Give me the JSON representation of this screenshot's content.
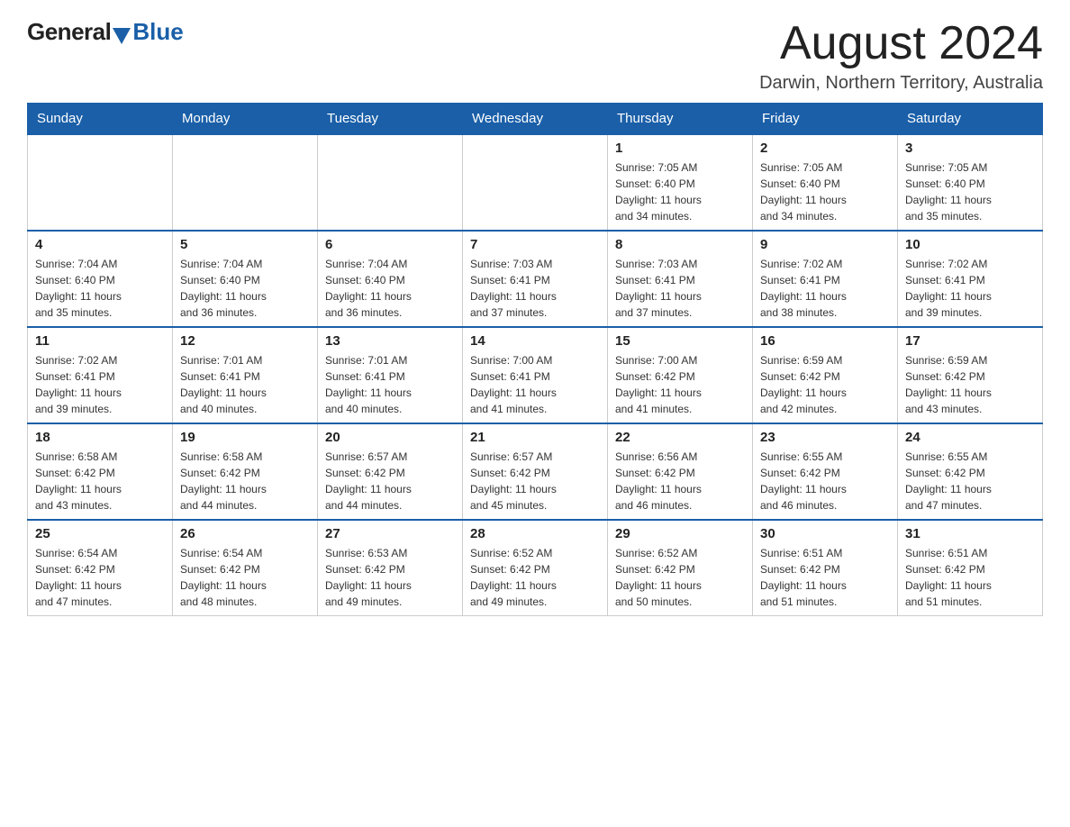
{
  "header": {
    "logo_general": "General",
    "logo_blue": "Blue",
    "month_title": "August 2024",
    "location": "Darwin, Northern Territory, Australia"
  },
  "days_of_week": [
    "Sunday",
    "Monday",
    "Tuesday",
    "Wednesday",
    "Thursday",
    "Friday",
    "Saturday"
  ],
  "weeks": [
    [
      {
        "day": "",
        "sunrise": "",
        "sunset": "",
        "daylight": ""
      },
      {
        "day": "",
        "sunrise": "",
        "sunset": "",
        "daylight": ""
      },
      {
        "day": "",
        "sunrise": "",
        "sunset": "",
        "daylight": ""
      },
      {
        "day": "",
        "sunrise": "",
        "sunset": "",
        "daylight": ""
      },
      {
        "day": "1",
        "sunrise": "Sunrise: 7:05 AM",
        "sunset": "Sunset: 6:40 PM",
        "daylight": "Daylight: 11 hours and 34 minutes."
      },
      {
        "day": "2",
        "sunrise": "Sunrise: 7:05 AM",
        "sunset": "Sunset: 6:40 PM",
        "daylight": "Daylight: 11 hours and 34 minutes."
      },
      {
        "day": "3",
        "sunrise": "Sunrise: 7:05 AM",
        "sunset": "Sunset: 6:40 PM",
        "daylight": "Daylight: 11 hours and 35 minutes."
      }
    ],
    [
      {
        "day": "4",
        "sunrise": "Sunrise: 7:04 AM",
        "sunset": "Sunset: 6:40 PM",
        "daylight": "Daylight: 11 hours and 35 minutes."
      },
      {
        "day": "5",
        "sunrise": "Sunrise: 7:04 AM",
        "sunset": "Sunset: 6:40 PM",
        "daylight": "Daylight: 11 hours and 36 minutes."
      },
      {
        "day": "6",
        "sunrise": "Sunrise: 7:04 AM",
        "sunset": "Sunset: 6:40 PM",
        "daylight": "Daylight: 11 hours and 36 minutes."
      },
      {
        "day": "7",
        "sunrise": "Sunrise: 7:03 AM",
        "sunset": "Sunset: 6:41 PM",
        "daylight": "Daylight: 11 hours and 37 minutes."
      },
      {
        "day": "8",
        "sunrise": "Sunrise: 7:03 AM",
        "sunset": "Sunset: 6:41 PM",
        "daylight": "Daylight: 11 hours and 37 minutes."
      },
      {
        "day": "9",
        "sunrise": "Sunrise: 7:02 AM",
        "sunset": "Sunset: 6:41 PM",
        "daylight": "Daylight: 11 hours and 38 minutes."
      },
      {
        "day": "10",
        "sunrise": "Sunrise: 7:02 AM",
        "sunset": "Sunset: 6:41 PM",
        "daylight": "Daylight: 11 hours and 39 minutes."
      }
    ],
    [
      {
        "day": "11",
        "sunrise": "Sunrise: 7:02 AM",
        "sunset": "Sunset: 6:41 PM",
        "daylight": "Daylight: 11 hours and 39 minutes."
      },
      {
        "day": "12",
        "sunrise": "Sunrise: 7:01 AM",
        "sunset": "Sunset: 6:41 PM",
        "daylight": "Daylight: 11 hours and 40 minutes."
      },
      {
        "day": "13",
        "sunrise": "Sunrise: 7:01 AM",
        "sunset": "Sunset: 6:41 PM",
        "daylight": "Daylight: 11 hours and 40 minutes."
      },
      {
        "day": "14",
        "sunrise": "Sunrise: 7:00 AM",
        "sunset": "Sunset: 6:41 PM",
        "daylight": "Daylight: 11 hours and 41 minutes."
      },
      {
        "day": "15",
        "sunrise": "Sunrise: 7:00 AM",
        "sunset": "Sunset: 6:42 PM",
        "daylight": "Daylight: 11 hours and 41 minutes."
      },
      {
        "day": "16",
        "sunrise": "Sunrise: 6:59 AM",
        "sunset": "Sunset: 6:42 PM",
        "daylight": "Daylight: 11 hours and 42 minutes."
      },
      {
        "day": "17",
        "sunrise": "Sunrise: 6:59 AM",
        "sunset": "Sunset: 6:42 PM",
        "daylight": "Daylight: 11 hours and 43 minutes."
      }
    ],
    [
      {
        "day": "18",
        "sunrise": "Sunrise: 6:58 AM",
        "sunset": "Sunset: 6:42 PM",
        "daylight": "Daylight: 11 hours and 43 minutes."
      },
      {
        "day": "19",
        "sunrise": "Sunrise: 6:58 AM",
        "sunset": "Sunset: 6:42 PM",
        "daylight": "Daylight: 11 hours and 44 minutes."
      },
      {
        "day": "20",
        "sunrise": "Sunrise: 6:57 AM",
        "sunset": "Sunset: 6:42 PM",
        "daylight": "Daylight: 11 hours and 44 minutes."
      },
      {
        "day": "21",
        "sunrise": "Sunrise: 6:57 AM",
        "sunset": "Sunset: 6:42 PM",
        "daylight": "Daylight: 11 hours and 45 minutes."
      },
      {
        "day": "22",
        "sunrise": "Sunrise: 6:56 AM",
        "sunset": "Sunset: 6:42 PM",
        "daylight": "Daylight: 11 hours and 46 minutes."
      },
      {
        "day": "23",
        "sunrise": "Sunrise: 6:55 AM",
        "sunset": "Sunset: 6:42 PM",
        "daylight": "Daylight: 11 hours and 46 minutes."
      },
      {
        "day": "24",
        "sunrise": "Sunrise: 6:55 AM",
        "sunset": "Sunset: 6:42 PM",
        "daylight": "Daylight: 11 hours and 47 minutes."
      }
    ],
    [
      {
        "day": "25",
        "sunrise": "Sunrise: 6:54 AM",
        "sunset": "Sunset: 6:42 PM",
        "daylight": "Daylight: 11 hours and 47 minutes."
      },
      {
        "day": "26",
        "sunrise": "Sunrise: 6:54 AM",
        "sunset": "Sunset: 6:42 PM",
        "daylight": "Daylight: 11 hours and 48 minutes."
      },
      {
        "day": "27",
        "sunrise": "Sunrise: 6:53 AM",
        "sunset": "Sunset: 6:42 PM",
        "daylight": "Daylight: 11 hours and 49 minutes."
      },
      {
        "day": "28",
        "sunrise": "Sunrise: 6:52 AM",
        "sunset": "Sunset: 6:42 PM",
        "daylight": "Daylight: 11 hours and 49 minutes."
      },
      {
        "day": "29",
        "sunrise": "Sunrise: 6:52 AM",
        "sunset": "Sunset: 6:42 PM",
        "daylight": "Daylight: 11 hours and 50 minutes."
      },
      {
        "day": "30",
        "sunrise": "Sunrise: 6:51 AM",
        "sunset": "Sunset: 6:42 PM",
        "daylight": "Daylight: 11 hours and 51 minutes."
      },
      {
        "day": "31",
        "sunrise": "Sunrise: 6:51 AM",
        "sunset": "Sunset: 6:42 PM",
        "daylight": "Daylight: 11 hours and 51 minutes."
      }
    ]
  ]
}
